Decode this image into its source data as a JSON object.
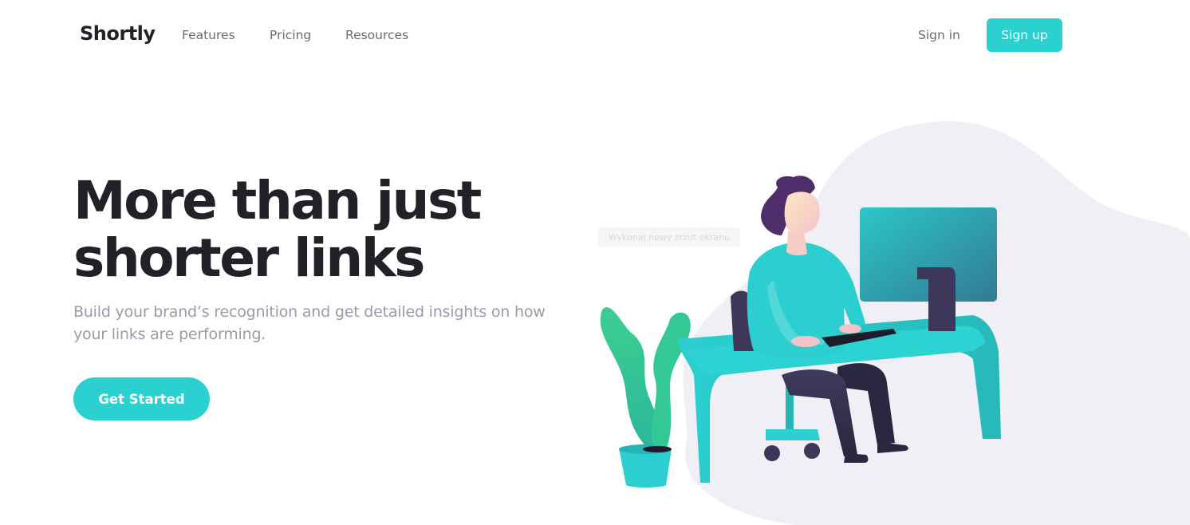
{
  "brand": {
    "name": "Shortly",
    "accent_color": "#2bd0d0",
    "text_dark": "#232127",
    "text_muted": "#9e9aa7"
  },
  "nav": {
    "items": [
      {
        "label": "Features"
      },
      {
        "label": "Pricing"
      },
      {
        "label": "Resources"
      }
    ],
    "signin_label": "Sign in",
    "signup_label": "Sign up"
  },
  "hero": {
    "title": "More than just shorter links",
    "subtitle": "Build your brand’s recognition and get detailed insights on how your links are performing.",
    "cta_label": "Get Started"
  },
  "overlay": {
    "tooltip_text": "Wykonaj nowy zrzut ekranu"
  },
  "illustration": {
    "name": "person-working-at-desk-illustration",
    "blob_color": "#efeff5"
  }
}
